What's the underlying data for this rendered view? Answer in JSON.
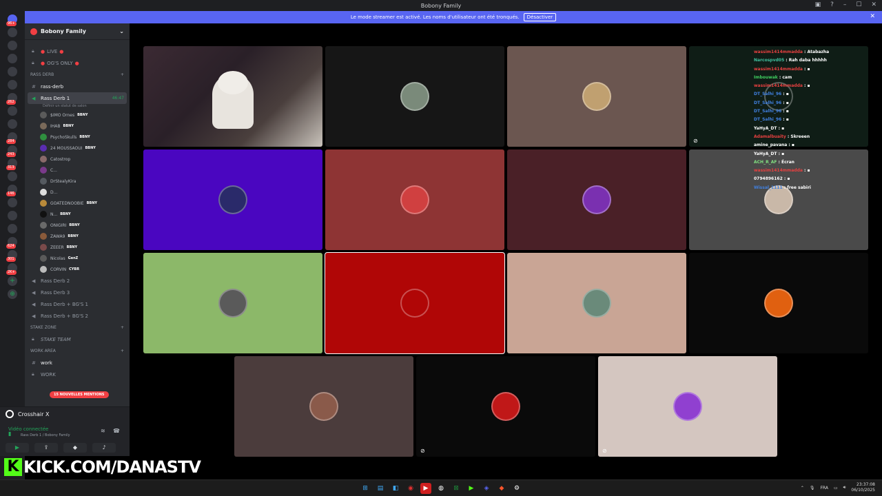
{
  "window": {
    "title": "Bobony Family"
  },
  "banner": {
    "text": "Le mode streamer est activé. Les noms d'utilisateur ont été tronqués.",
    "button": "Désactiver"
  },
  "guild_badges": [
    "96+",
    "",
    "",
    "",
    "",
    "",
    "262",
    "",
    "",
    "284",
    "243",
    "313",
    "",
    "146",
    "",
    "",
    "",
    "624",
    "301",
    "2K+"
  ],
  "server": {
    "name": "Bobony Family"
  },
  "channels": {
    "live": "LIVE",
    "ogs": "OG'S ONLY",
    "cat_rass": "RASS DERB",
    "rass_derb_text": "rass-derb",
    "rass_derb_1": "Rass Derb 1",
    "rass_derb_1_time": "46:47",
    "rass_derb_1_status": "Définir un statut de salon",
    "rass_derb_2": "Rass Derb 2",
    "rass_derb_3": "Rass Derb 3",
    "rass_derb_bgs1": "Rass Derb + BG'S 1",
    "rass_derb_bgs2": "Rass Derb + BG'S 2",
    "cat_stake": "STAKE ZONE",
    "stake_team": "STAKE TEAM",
    "cat_work": "WORK AREA",
    "work_text": "work",
    "work_voice": "WORK"
  },
  "voice_users": [
    {
      "name": "$IMO Ornes",
      "tag": "BBNY",
      "color": "#5b5b5b"
    },
    {
      "name": "IHAB",
      "tag": "BBNY",
      "color": "#7a6a5a"
    },
    {
      "name": "PsychoSkulls",
      "tag": "BBNY",
      "color": "#2f8f3f"
    },
    {
      "name": "24 MOUSSAOUI",
      "tag": "BBNY",
      "color": "#5a2db0"
    },
    {
      "name": "Catostrop",
      "tag": "",
      "color": "#8a6a6a"
    },
    {
      "name": "C...",
      "tag": "",
      "color": "#7a3a8a"
    },
    {
      "name": "DrStealyKira",
      "tag": "",
      "color": "#555a60"
    },
    {
      "name": "D...",
      "tag": "",
      "color": "#ddd"
    },
    {
      "name": "GOATEDNOOBIE",
      "tag": "BBNY",
      "color": "#b98a3a"
    },
    {
      "name": "N...",
      "tag": "BBNY",
      "color": "#111"
    },
    {
      "name": "ONIGIRI",
      "tag": "BBNY",
      "color": "#6a6a6a"
    },
    {
      "name": "ZAWA9",
      "tag": "BBNY",
      "color": "#8a5a3a"
    },
    {
      "name": "ZEEER",
      "tag": "BBNY",
      "color": "#7a4a4a"
    },
    {
      "name": "Nicolas",
      "tag": "GenZ",
      "color": "#5a5a5a"
    },
    {
      "name": "CORVIN",
      "tag": "CYBR",
      "color": "#bbb"
    }
  ],
  "mentions": "15 NOUVELLES MENTIONS",
  "activity": {
    "name": "Crosshair X"
  },
  "voice_status": {
    "label": "Vidéo connectée",
    "location": "Rass Derb 1 / Bobony Family"
  },
  "kick": {
    "k": "K",
    "text": "KICK.COM/DANASTV"
  },
  "tiles": [
    {
      "bg": "#2e2a2a",
      "avatar": "#caa"
    },
    {
      "bg": "#161616",
      "avatar": "#7a8a7a"
    },
    {
      "bg": "#6b5650",
      "avatar": "#c0a070"
    },
    {
      "bg": "#0f1d16",
      "avatar": "#0f1d16"
    },
    {
      "bg": "#4a06c0",
      "avatar": "#2a2a6a"
    },
    {
      "bg": "#8e3434",
      "avatar": "#d04040"
    },
    {
      "bg": "#4a2027",
      "avatar": "#7a30b0"
    },
    {
      "bg": "#4a4a4a",
      "avatar": "#c9b8a8"
    },
    {
      "bg": "#8cb869",
      "avatar": "#5a5a5a"
    },
    {
      "bg": "#b00606",
      "avatar": "#b00606"
    },
    {
      "bg": "#c9a595",
      "avatar": "#6a8a7a"
    },
    {
      "bg": "#0a0a0a",
      "avatar": "#e06010"
    },
    {
      "bg": "#4b3c3c",
      "avatar": "#8a5a4a"
    },
    {
      "bg": "#0a0a0a",
      "avatar": "#c01818"
    },
    {
      "bg": "#d4c6c0",
      "avatar": "#9040d0"
    }
  ],
  "chat": [
    {
      "user": "wassim1414mmadda",
      "msg": "Atabazha",
      "color": "#e84040"
    },
    {
      "user": "Narcospvd05",
      "msg": "Rah daba hhhhh",
      "color": "#40c0a0"
    },
    {
      "user": "wassim1414mmadda",
      "msg": "▪",
      "color": "#e84040"
    },
    {
      "user": "Imbouwak",
      "msg": "cam",
      "color": "#40d060"
    },
    {
      "user": "wassim1414mmadda",
      "msg": "▪",
      "color": "#e84040"
    },
    {
      "user": "DT_Salhi_96",
      "msg": "▪",
      "color": "#4080e0"
    },
    {
      "user": "DT_Salhi_96",
      "msg": "▪",
      "color": "#4080e0"
    },
    {
      "user": "DT_Salhi_96",
      "msg": "▪",
      "color": "#4080e0"
    },
    {
      "user": "DT_Salhi_96",
      "msg": "▪",
      "color": "#4080e0"
    },
    {
      "user": "YaHyA_DT",
      "msg": "▪",
      "color": "#fff"
    },
    {
      "user": "Adamalbuaity",
      "msg": "Skreeen",
      "color": "#e84040"
    },
    {
      "user": "amine_pavana",
      "msg": "▪",
      "color": "#fff"
    },
    {
      "user": "YaHyA_DT",
      "msg": "▪",
      "color": "#fff"
    },
    {
      "user": "ACH_R_AF",
      "msg": "Écran",
      "color": "#80e080"
    },
    {
      "user": "wassim1414mmadda",
      "msg": "▪",
      "color": "#e84040"
    },
    {
      "user": "0794896162",
      "msg": "▪",
      "color": "#fff"
    },
    {
      "user": "Wissal_1111",
      "msg": "free sabiri",
      "color": "#4080e0"
    }
  ],
  "tray": {
    "lang": "FRA",
    "time": "23:37:08",
    "date": "06/10/2025"
  },
  "colors": {
    "accent": "#5865f2",
    "online": "#23a55a",
    "danger": "#f23f43",
    "kick": "#53fc18"
  }
}
